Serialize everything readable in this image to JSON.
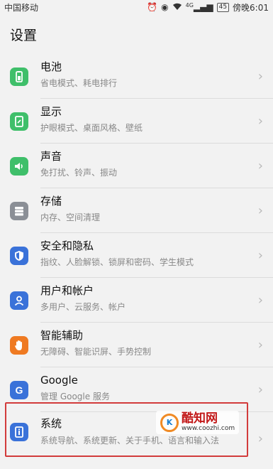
{
  "status_bar": {
    "carrier": "中国移动",
    "signal": "4G",
    "battery": "45",
    "time": "傍晚6:01"
  },
  "page_title": "设置",
  "items": [
    {
      "label": "电池",
      "sub": "省电模式、耗电排行",
      "icon": "battery-icon",
      "color": "#3fbf6a"
    },
    {
      "label": "显示",
      "sub": "护眼模式、桌面风格、壁纸",
      "icon": "display-icon",
      "color": "#3fbf6a"
    },
    {
      "label": "声音",
      "sub": "免打扰、铃声、振动",
      "icon": "sound-icon",
      "color": "#3fbf6a"
    },
    {
      "label": "存储",
      "sub": "内存、空间清理",
      "icon": "storage-icon",
      "color": "#8b8f96"
    },
    {
      "label": "安全和隐私",
      "sub": "指纹、人脸解锁、锁屏和密码、学生模式",
      "icon": "shield-icon",
      "color": "#3a72d9"
    },
    {
      "label": "用户和帐户",
      "sub": "多用户、云服务、帐户",
      "icon": "user-icon",
      "color": "#3a72d9"
    },
    {
      "label": "智能辅助",
      "sub": "无障碍、智能识屏、手势控制",
      "icon": "hand-icon",
      "color": "#ef7a22"
    },
    {
      "label": "Google",
      "sub": "管理 Google 服务",
      "icon": "google-icon",
      "color": "#3a72d9"
    },
    {
      "label": "系统",
      "sub": "系统导航、系统更新、关于手机、语言和输入法",
      "icon": "system-icon",
      "color": "#3a72d9"
    }
  ],
  "watermark": {
    "name": "酷知网",
    "url": "www.coozhi.com"
  }
}
